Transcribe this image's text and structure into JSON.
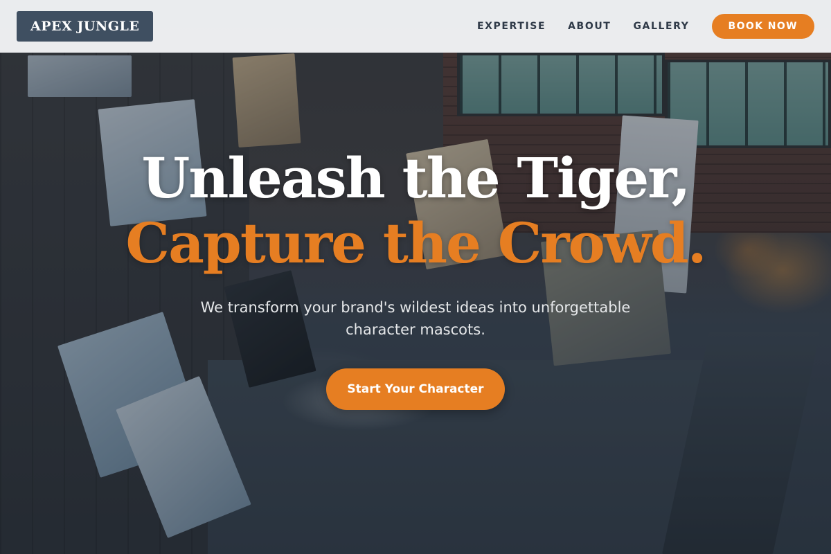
{
  "brand": {
    "logo_text": "APEX JUNGLE"
  },
  "nav": {
    "links": [
      {
        "label": "EXPERTISE"
      },
      {
        "label": "ABOUT"
      },
      {
        "label": "GALLERY"
      }
    ],
    "cta_label": "BOOK NOW"
  },
  "hero": {
    "headline_line1": "Unleash the Tiger,",
    "headline_line2": "Capture the Crowd.",
    "subtitle": "We transform your brand's wildest ideas into unforgettable character mascots.",
    "cta_label": "Start Your Character",
    "background": "art-studio-photo"
  },
  "colors": {
    "accent": "#e67e22",
    "logo_bg": "#3f4f61",
    "nav_text": "#2f3a48",
    "header_bg": "#f3f4f6"
  }
}
